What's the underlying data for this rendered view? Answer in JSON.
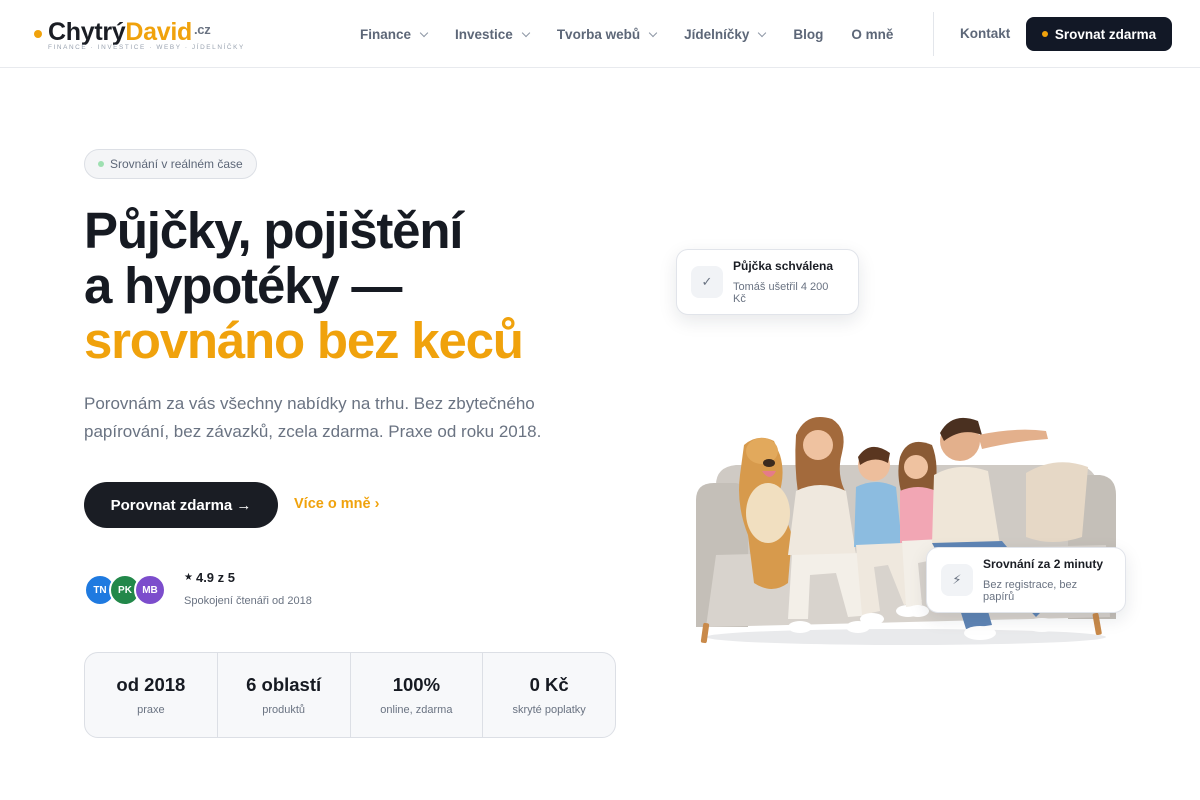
{
  "brand": {
    "name_part1": "Chytrý",
    "name_part2": "David",
    "tld": ".cz",
    "tagline": "FINANCE · INVESTICE · WEBY · JÍDELNÍČKY"
  },
  "nav": {
    "items": [
      {
        "label": "Finance",
        "dropdown": true
      },
      {
        "label": "Investice",
        "dropdown": true
      },
      {
        "label": "Tvorba webů",
        "dropdown": true
      },
      {
        "label": "Jídelníčky",
        "dropdown": true
      },
      {
        "label": "Blog",
        "dropdown": false
      },
      {
        "label": "O mně",
        "dropdown": false
      }
    ],
    "contact_label": "Kontakt",
    "cta_label": "Srovnat zdarma"
  },
  "hero": {
    "badge": "Srovnání v reálném čase",
    "title_line1": "Půjčky, pojištění",
    "title_line2": "a hypotéky —",
    "title_accent": "srovnáno bez keců",
    "lead": "Porovnám za vás všechny nabídky na trhu. Bez zbytečného papírování, bez závazků, zcela zdarma. Praxe od roku 2018.",
    "primary_button": "Porovnat zdarma →",
    "secondary_link": "Více o mně ›"
  },
  "social_proof": {
    "avatars": [
      {
        "initials": "TN",
        "color": "#1f7ae0"
      },
      {
        "initials": "PK",
        "color": "#22884a"
      },
      {
        "initials": "MB",
        "color": "#7c4dcc"
      }
    ],
    "rating": "4.9 z 5",
    "rating_sub": "Spokojení čtenáři od 2018"
  },
  "stats": [
    {
      "value": "od 2018",
      "label": "praxe"
    },
    {
      "value": "6 oblastí",
      "label": "produktů"
    },
    {
      "value": "100%",
      "label": "online, zdarma"
    },
    {
      "value": "0 Kč",
      "label": "skryté poplatky"
    }
  ],
  "cards": {
    "approved": {
      "title": "Půjčka schválena",
      "subtitle": "Tomáš ušetřil 4 200 Kč",
      "icon": "check-icon"
    },
    "fast": {
      "title": "Srovnání za 2 minuty",
      "subtitle": "Bez registrace, bez papírů",
      "icon": "lightning-icon"
    }
  },
  "colors": {
    "accent": "#f0a20c",
    "dark": "#121826",
    "muted": "#6a7382"
  }
}
